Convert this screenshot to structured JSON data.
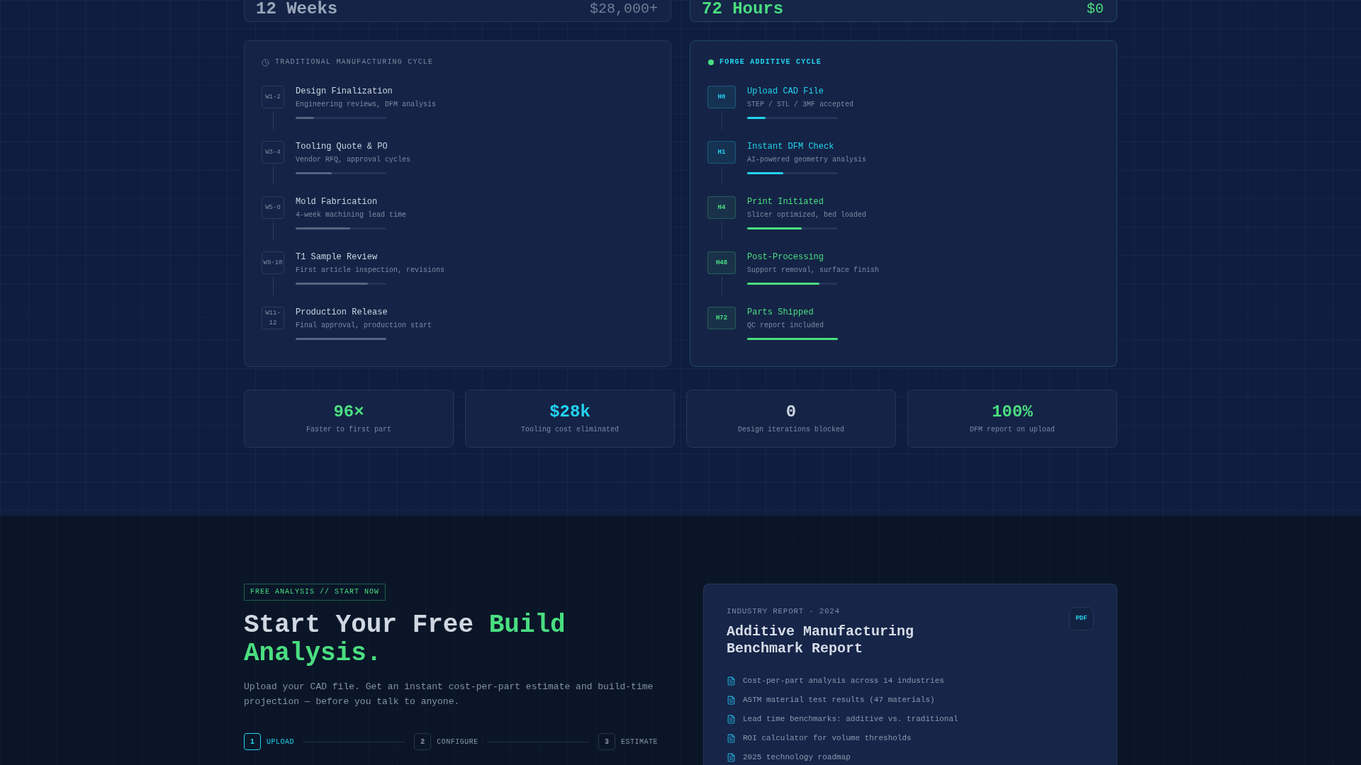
{
  "summary_cards": [
    {
      "kind": "traditional",
      "duration": "12 Weeks",
      "cost": "$28,000+"
    },
    {
      "kind": "forge",
      "duration": "72 Hours",
      "cost": "$0"
    }
  ],
  "traditional_cycle": {
    "title": "TRADITIONAL MANUFACTURING CYCLE",
    "steps": [
      {
        "marker": "W1-2",
        "title": "Design Finalization",
        "description": "Engineering reviews, DFM analysis",
        "level": 0.2
      },
      {
        "marker": "W3-4",
        "title": "Tooling Quote & PO",
        "description": "Vendor RFQ, approval cycles",
        "level": 0.4
      },
      {
        "marker": "W5-8",
        "title": "Mold Fabrication",
        "description": "4-week machining lead time",
        "level": 0.6
      },
      {
        "marker": "W9-10",
        "title": "T1 Sample Review",
        "description": "First article inspection, revisions",
        "level": 0.8
      },
      {
        "marker": "W11-12",
        "title": "Production Release",
        "description": "Final approval, production start",
        "level": 1
      }
    ]
  },
  "forge_cycle": {
    "title": "FORGE ADDITIVE CYCLE",
    "steps": [
      {
        "marker": "H0",
        "title": "Upload CAD File",
        "description": "STEP / STL / 3MF accepted",
        "level": 0.2,
        "color": "#22d3ee"
      },
      {
        "marker": "H1",
        "title": "Instant DFM Check",
        "description": "AI-powered geometry analysis",
        "level": 0.4,
        "color": "#22d3ee"
      },
      {
        "marker": "H4",
        "title": "Print Initiated",
        "description": "Slicer optimized, bed loaded",
        "level": 0.6,
        "color": "#4ade80"
      },
      {
        "marker": "H48",
        "title": "Post-Processing",
        "description": "Support removal, surface finish",
        "level": 0.8,
        "color": "#4ade80"
      },
      {
        "marker": "H72",
        "title": "Parts Shipped",
        "description": "QC report included",
        "level": 1,
        "color": "#4ade80"
      }
    ]
  },
  "stats": [
    {
      "value": "96×",
      "label": "Faster to first part",
      "color": "#4ade80"
    },
    {
      "value": "$28k",
      "label": "Tooling cost eliminated",
      "color": "#22d3ee"
    },
    {
      "value": "0",
      "label": "Design iterations blocked",
      "color": "#cbd5e1"
    },
    {
      "value": "100%",
      "label": "DFM report on upload",
      "color": "#4ade80"
    }
  ],
  "cta": {
    "eyebrow": "FREE ANALYSIS // START NOW",
    "heading": {
      "lead": "Start Your Free",
      "highlight": "Build Analysis."
    },
    "description": "Upload your CAD file. Get an instant cost-per-part estimate and build-time projection — before you talk to anyone.",
    "steps": [
      {
        "number": "1",
        "label": "UPLOAD",
        "selected": true
      },
      {
        "number": "2",
        "label": "CONFIGURE",
        "selected": false
      },
      {
        "number": "3",
        "label": "ESTIMATE",
        "selected": false
      }
    ]
  },
  "report": {
    "eyebrow": "INDUSTRY REPORT · 2024",
    "title": "Additive Manufacturing Benchmark Report",
    "file_type": "PDF",
    "items": [
      "Cost-per-part analysis across 14 industries",
      "ASTM material test results (47 materials)",
      "Lead time benchmarks: additive vs. traditional",
      "ROI calculator for volume thresholds",
      "2025 technology roadmap"
    ]
  }
}
